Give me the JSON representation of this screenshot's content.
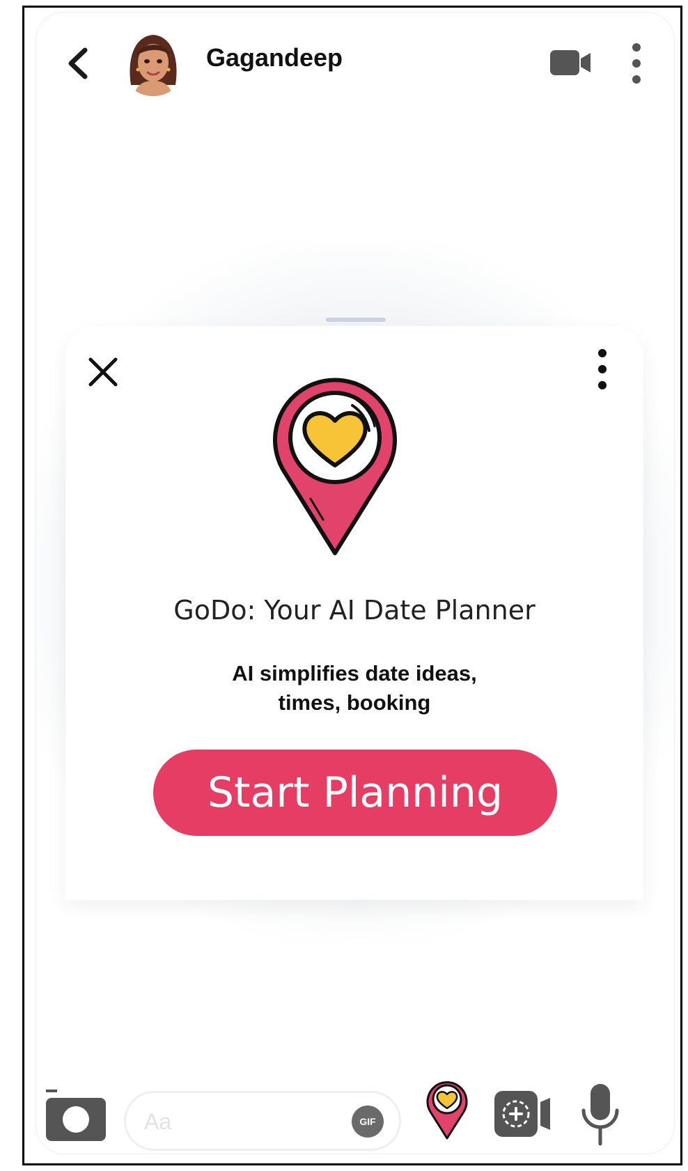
{
  "header": {
    "contact_name": "Gagandeep",
    "icons": [
      "back-chevron-icon",
      "avatar",
      "video-camera-icon",
      "more-vertical-icon"
    ]
  },
  "card": {
    "title": "GoDo: Your AI Date Planner",
    "subtitle_line1": "AI simplifies date ideas,",
    "subtitle_line2": "times, booking",
    "cta_label": "Start Planning",
    "icons": [
      "close-icon",
      "more-vertical-icon",
      "heart-location-pin-icon"
    ]
  },
  "composer": {
    "placeholder": "Aa",
    "gif_label": "GIF",
    "icons": [
      "camera-icon",
      "gif-icon",
      "heart-location-pin-icon",
      "screen-record-icon",
      "microphone-icon"
    ]
  },
  "colors": {
    "accent": "#e53d64",
    "pin_red": "#e2436a",
    "heart_yellow": "#f6c436",
    "icon_gray": "#6a6a6a"
  }
}
